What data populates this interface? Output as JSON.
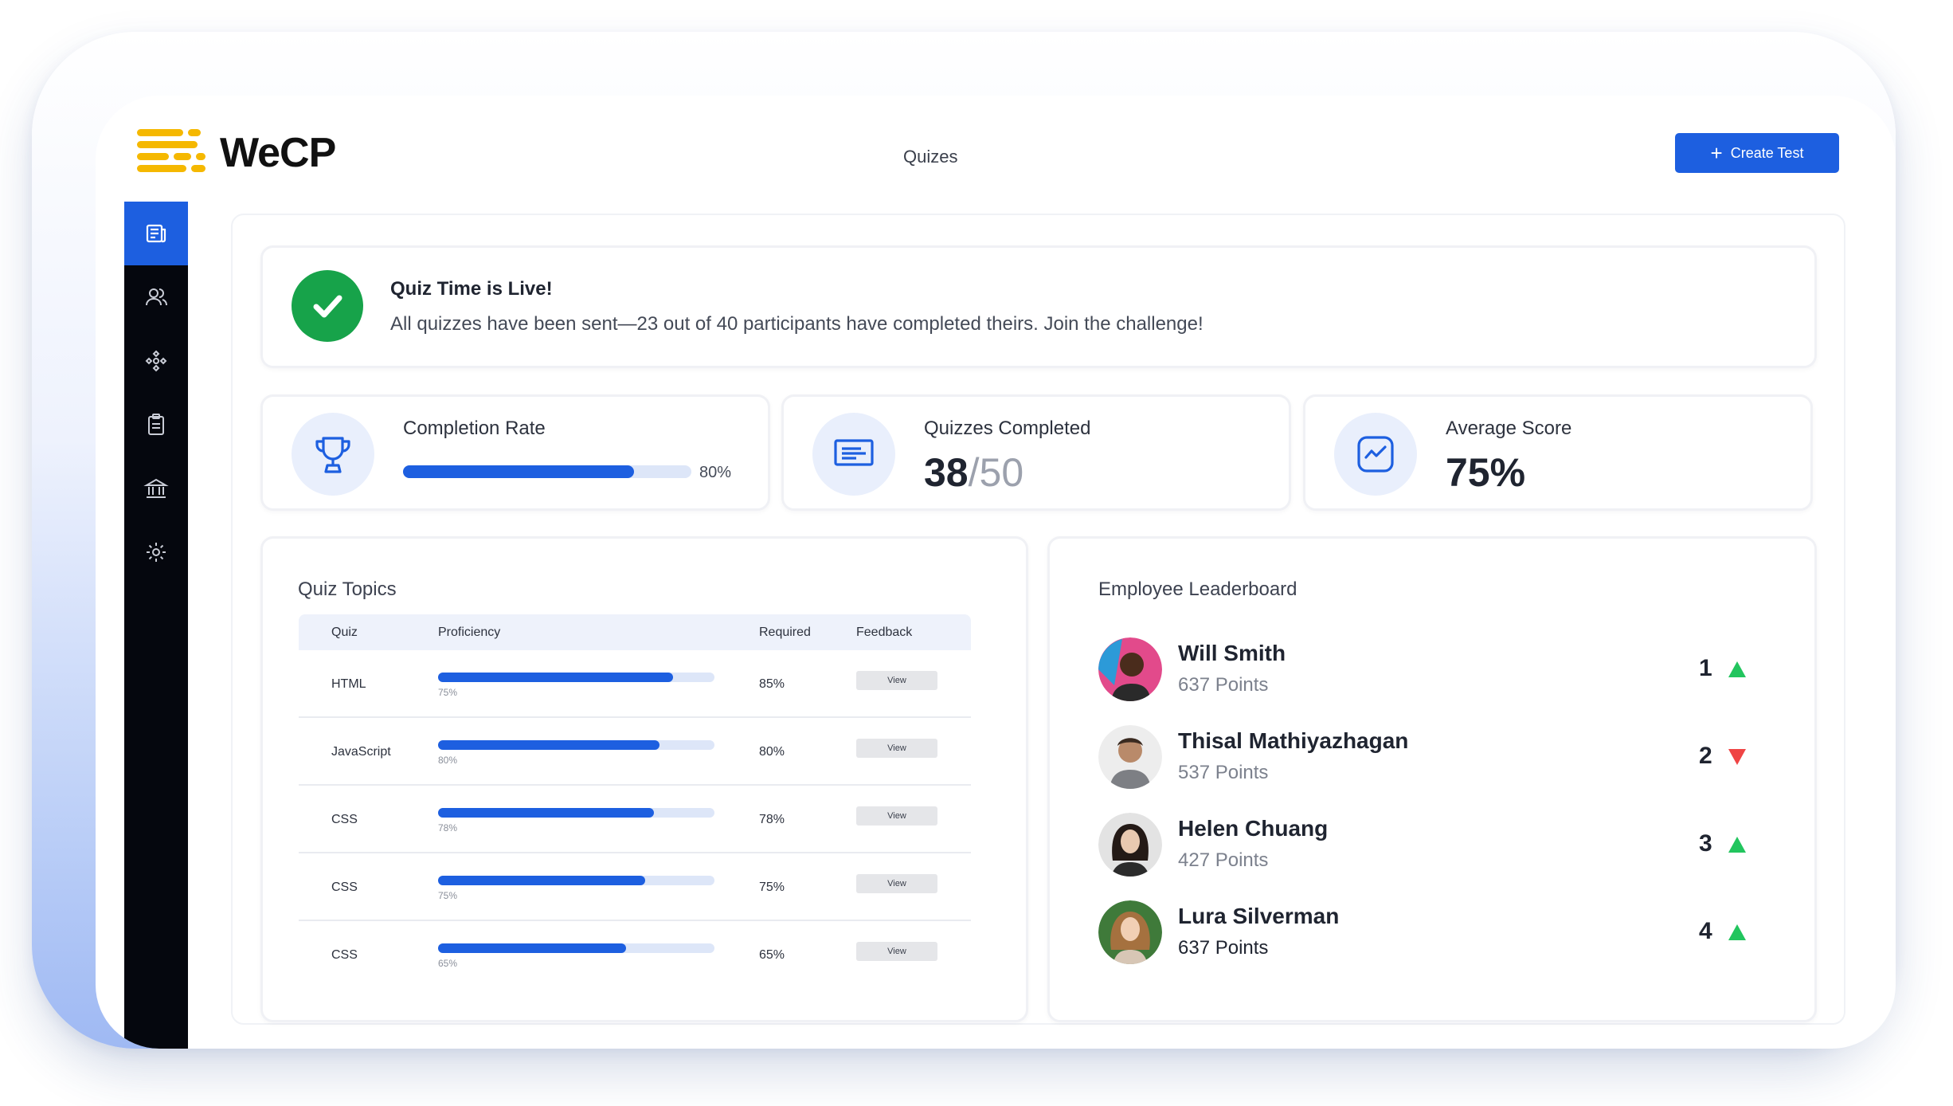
{
  "header": {
    "logo_text": "WeCP",
    "page_title": "Quizes",
    "create_button_label": "Create Test"
  },
  "sidebar": {
    "items": [
      {
        "icon": "document-icon",
        "active": true
      },
      {
        "icon": "users-icon",
        "active": false
      },
      {
        "icon": "network-icon",
        "active": false
      },
      {
        "icon": "clipboard-icon",
        "active": false
      },
      {
        "icon": "bank-icon",
        "active": false
      },
      {
        "icon": "gear-icon",
        "active": false
      }
    ]
  },
  "banner": {
    "title": "Quiz Time is Live!",
    "message": "All quizzes have been sent—23 out of 40 participants have completed theirs. Join the challenge!",
    "status_color": "#17a34a"
  },
  "stats": {
    "completion": {
      "label": "Completion Rate",
      "value_text": "80%",
      "value": 0.8
    },
    "quizzes": {
      "label": "Quizzes Completed",
      "completed": "38",
      "total": "/50"
    },
    "average": {
      "label": "Average Score",
      "value": "75%"
    }
  },
  "topics": {
    "title": "Quiz Topics",
    "columns": [
      "Quiz",
      "Proficiency",
      "Required",
      "Feedback"
    ],
    "rows": [
      {
        "quiz": "HTML",
        "proficiency": 0.85,
        "proficiency_label": "75%",
        "required": "85%",
        "feedback": "View"
      },
      {
        "quiz": "JavaScript",
        "proficiency": 0.8,
        "proficiency_label": "80%",
        "required": "80%",
        "feedback": "View"
      },
      {
        "quiz": "CSS",
        "proficiency": 0.78,
        "proficiency_label": "78%",
        "required": "78%",
        "feedback": "View"
      },
      {
        "quiz": "CSS",
        "proficiency": 0.75,
        "proficiency_label": "75%",
        "required": "75%",
        "feedback": "View"
      },
      {
        "quiz": "CSS",
        "proficiency": 0.68,
        "proficiency_label": "65%",
        "required": "65%",
        "feedback": "View"
      }
    ]
  },
  "leaderboard": {
    "title": "Employee Leaderboard",
    "entries": [
      {
        "name": "Will Smith",
        "points": "637 Points",
        "rank": "1",
        "trend": "up"
      },
      {
        "name": "Thisal Mathiyazhagan",
        "points": "537 Points",
        "rank": "2",
        "trend": "down"
      },
      {
        "name": "Helen Chuang",
        "points": "427 Points",
        "rank": "3",
        "trend": "up"
      },
      {
        "name": "Lura Silverman",
        "points": "637 Points",
        "rank": "4",
        "trend": "up"
      }
    ]
  },
  "colors": {
    "accent": "#1d5fe0",
    "logo": "#f5b800",
    "trend_up": "#22c55e",
    "trend_down": "#ef4444"
  }
}
